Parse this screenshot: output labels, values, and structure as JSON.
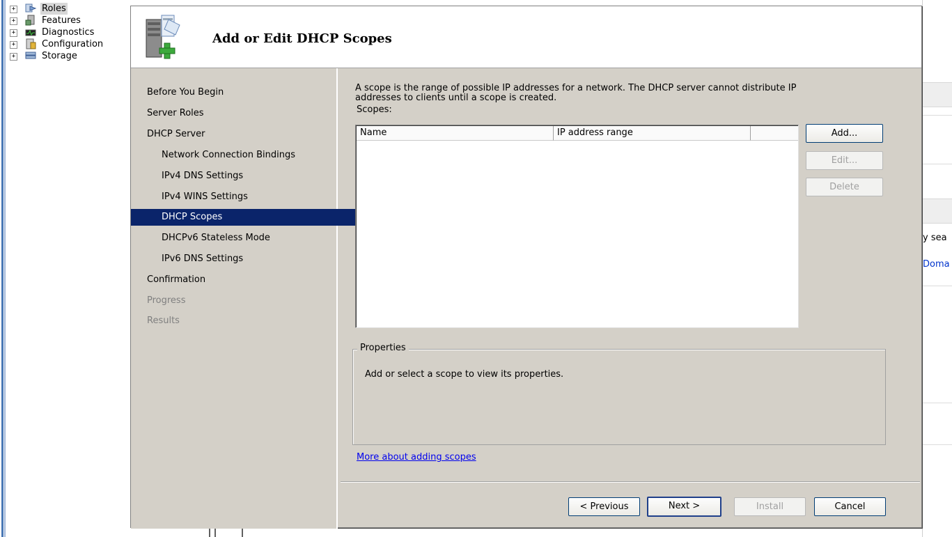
{
  "tree": {
    "items": [
      {
        "label": "Roles",
        "icon": "roles-icon",
        "expander": "+"
      },
      {
        "label": "Features",
        "icon": "features-icon",
        "expander": "+"
      },
      {
        "label": "Diagnostics",
        "icon": "diagnostics-icon",
        "expander": "+"
      },
      {
        "label": "Configuration",
        "icon": "configuration-icon",
        "expander": "+"
      },
      {
        "label": "Storage",
        "icon": "storage-icon",
        "expander": "+"
      }
    ]
  },
  "background_panel": {
    "text1": "y sea",
    "link1": "Doma"
  },
  "wizard": {
    "title": "Add or Edit DHCP Scopes",
    "nav": [
      {
        "label": "Before You Begin",
        "state": "normal"
      },
      {
        "label": "Server Roles",
        "state": "normal"
      },
      {
        "label": "DHCP Server",
        "state": "normal"
      },
      {
        "label": "Network Connection Bindings",
        "state": "sub"
      },
      {
        "label": "IPv4 DNS Settings",
        "state": "sub"
      },
      {
        "label": "IPv4 WINS Settings",
        "state": "sub"
      },
      {
        "label": "DHCP Scopes",
        "state": "selected"
      },
      {
        "label": "DHCPv6 Stateless Mode",
        "state": "sub"
      },
      {
        "label": "IPv6 DNS Settings",
        "state": "sub"
      },
      {
        "label": "Confirmation",
        "state": "normal"
      },
      {
        "label": "Progress",
        "state": "disabled"
      },
      {
        "label": "Results",
        "state": "disabled"
      }
    ],
    "description_line1": "A scope is the range of possible IP addresses for a network. The DHCP server cannot distribute IP",
    "description_line2": "addresses to clients until a scope is created.",
    "scopes_label": "Scopes:",
    "columns": [
      "Name",
      "IP address range",
      ""
    ],
    "buttons": {
      "add": "Add...",
      "edit": "Edit...",
      "delete": "Delete"
    },
    "properties": {
      "legend": "Properties",
      "text": "Add or select a scope to view its properties."
    },
    "more_link": "More about adding scopes",
    "footer": {
      "previous": "< Previous",
      "next": "Next >",
      "install": "Install",
      "cancel": "Cancel"
    }
  },
  "colors": {
    "selection": "#0a246a",
    "dialog_bg": "#d4d0c8",
    "link": "#0000ee"
  }
}
